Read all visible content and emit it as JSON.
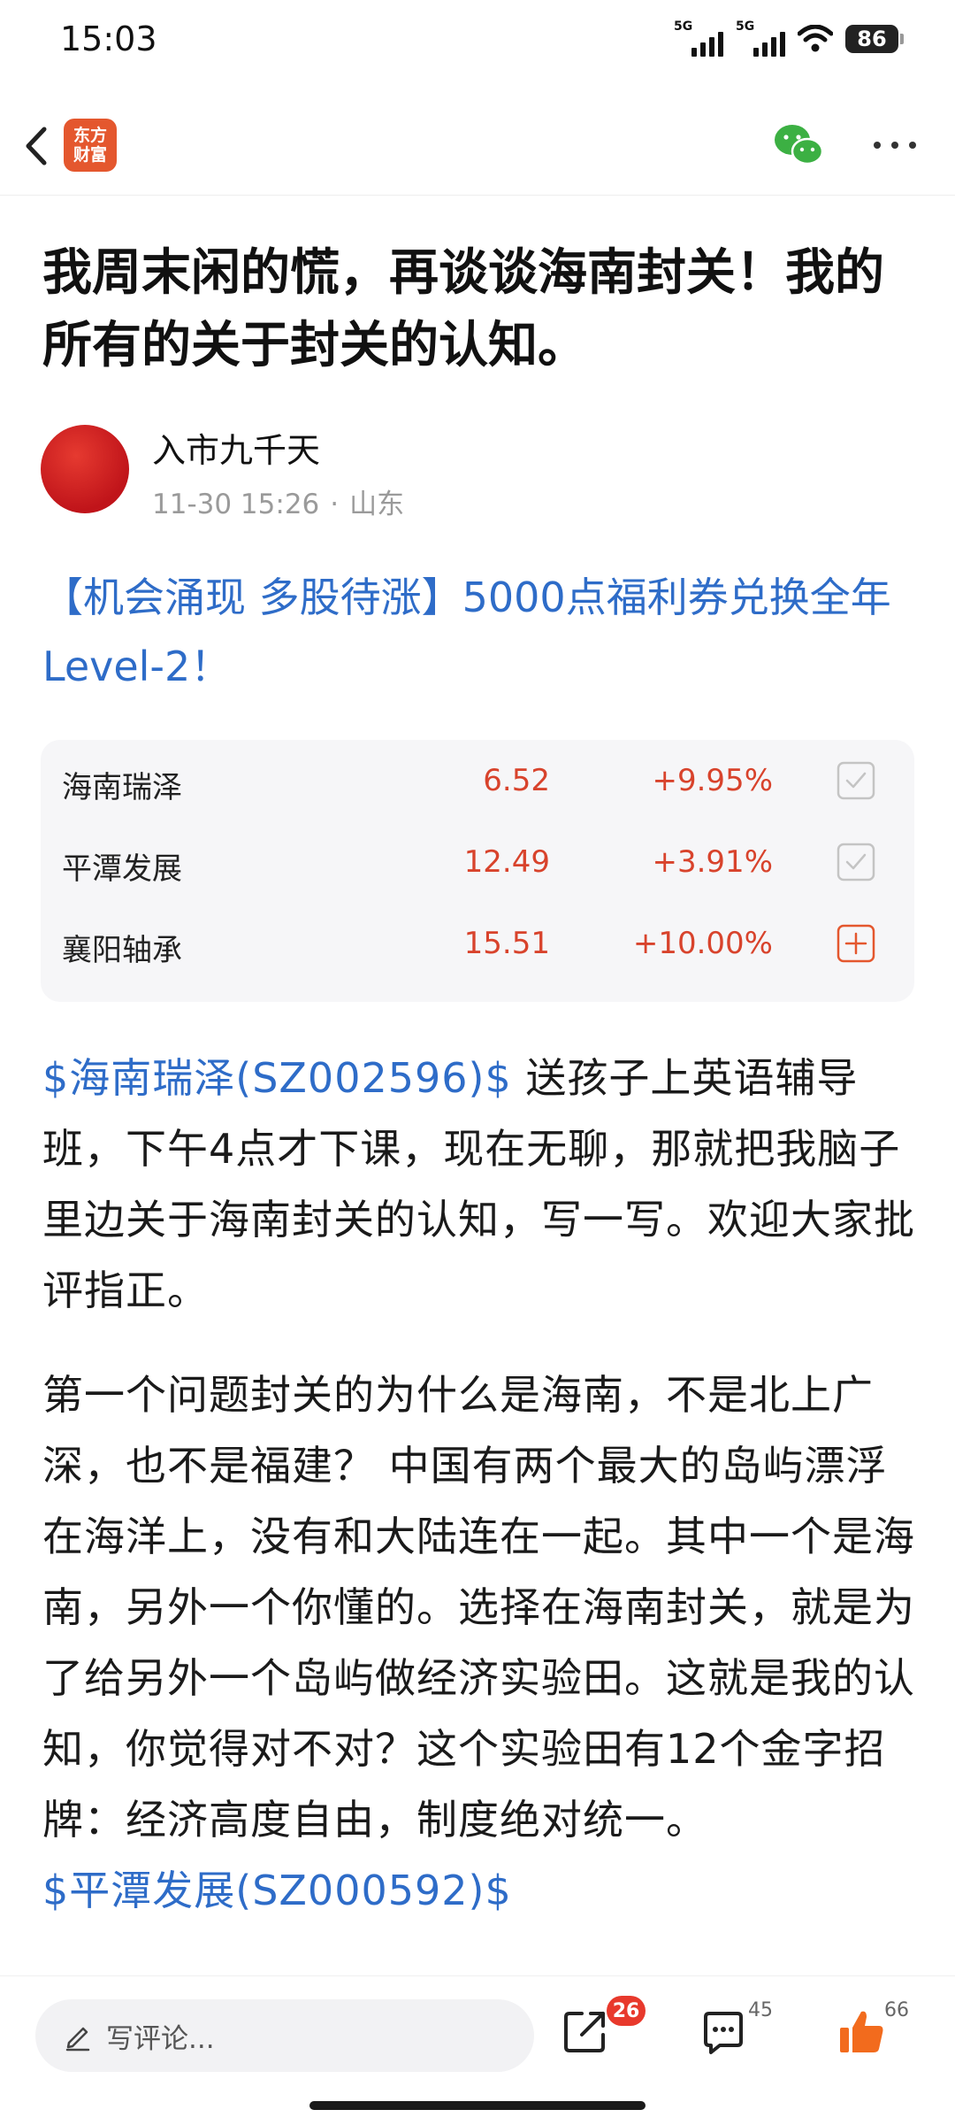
{
  "status_bar": {
    "time": "15:03",
    "signal_1_label": "5G",
    "signal_2_label": "5G",
    "battery": "86"
  },
  "nav": {
    "logo_line1": "东方",
    "logo_line2": "财富",
    "icons": [
      "back-icon",
      "wechat-icon",
      "more-icon"
    ]
  },
  "article": {
    "title": "我周末闲的慌，再谈谈海南封关！我的所有的关于封关的认知。",
    "author": "入市九千天",
    "date": "11-30 15:26",
    "location": "山东",
    "promo": "【机会涌现 多股待涨】5000点福利券兑换全年Level-2！"
  },
  "stocks": [
    {
      "name": "海南瑞泽",
      "price": "6.52",
      "change": "+9.95%",
      "status": "added"
    },
    {
      "name": "平潭发展",
      "price": "12.49",
      "change": "+3.91%",
      "status": "added"
    },
    {
      "name": "襄阳轴承",
      "price": "15.51",
      "change": "+10.00%",
      "status": "add"
    }
  ],
  "body": {
    "p1_link": "$海南瑞泽(SZ002596)$",
    "p1_text": " 送孩子上英语辅导班，下午4点才下课，现在无聊，那就把我脑子里边关于海南封关的认知，写一写。欢迎大家批评指正。",
    "p2_text": "第一个问题封关的为什么是海南，不是北上广深，也不是福建？ 中国有两个最大的岛屿漂浮在海洋上，没有和大陆连在一起。其中一个是海南，另外一个你懂的。选择在海南封关，就是为了给另外一个岛屿做经济实验田。这就是我的认知，你觉得对不对？这个实验田有12个金字招牌：经济高度自由，制度绝对统一。",
    "p2_link": "$平潭发展(SZ000592)$"
  },
  "bottom_bar": {
    "comment_placeholder": "写评论...",
    "share_badge": "26",
    "comment_count": "45",
    "like_count": "66",
    "accent_color": "#e8392c"
  }
}
